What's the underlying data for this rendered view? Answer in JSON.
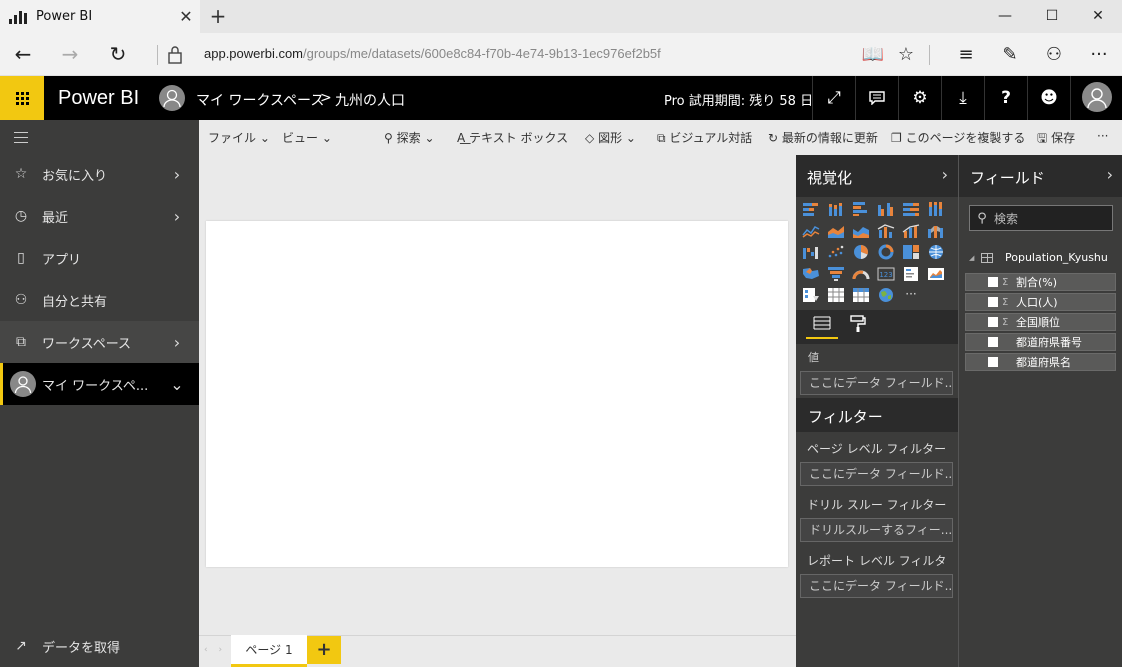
{
  "browser": {
    "tab_title": "Power BI",
    "tab_close": "✕",
    "new_tab": "+",
    "url_host": "app.powerbi.com",
    "url_path": "/groups/me/datasets/600e8c84-f70b-4e74-9b13-1ec976ef2b5f",
    "window_controls": [
      "—",
      "☐",
      "✕"
    ]
  },
  "header": {
    "brand": "Power BI",
    "breadcrumb_workspace": "マイ ワークスペース",
    "breadcrumb_sep": ">",
    "breadcrumb_dataset": "九州の人口",
    "trial_text": "Pro 試用期間: 残り 58 日",
    "icons": [
      "expand-icon",
      "feedback-icon",
      "settings-icon",
      "download-icon",
      "help-icon",
      "smiley-icon"
    ]
  },
  "leftnav": {
    "items": [
      {
        "label": "お気に入り",
        "icon": "star-icon",
        "glyph": "☆",
        "chevron": "›"
      },
      {
        "label": "最近",
        "icon": "clock-icon",
        "glyph": "◷",
        "chevron": "›"
      },
      {
        "label": "アプリ",
        "icon": "apps-icon",
        "glyph": "▯",
        "chevron": ""
      },
      {
        "label": "自分と共有",
        "icon": "share-icon",
        "glyph": "⚇",
        "chevron": ""
      },
      {
        "label": "ワークスペース",
        "icon": "workspace-icon",
        "glyph": "⧉",
        "chevron": "›"
      },
      {
        "label": "マイ ワークスペ...",
        "icon": "avatar-icon",
        "glyph": "",
        "chevron": "⌄"
      }
    ],
    "get_data": "データを取得",
    "get_data_glyph": "↗"
  },
  "toolbar": {
    "file": "ファイル",
    "view": "ビュー",
    "explore": "探索",
    "textbox": "テキスト ボックス",
    "shapes": "図形",
    "visual_qa": "ビジュアル対話",
    "refresh": "最新の情報に更新",
    "duplicate": "このページを複製する",
    "save": "保存",
    "more": "···"
  },
  "pages": {
    "current": "ページ 1",
    "add": "+",
    "nav": "‹ ›"
  },
  "visualizations": {
    "title": "視覚化",
    "chevron": "›",
    "more": "···",
    "values_label": "値",
    "values_placeholder": "ここにデータ フィールド...",
    "filters_title": "フィルター",
    "page_filter_label": "ページ レベル フィルター",
    "page_filter_placeholder": "ここにデータ フィールド...",
    "drill_filter_label": "ドリル スルー フィルター",
    "drill_filter_placeholder": "ドリルスルーするフィー...",
    "report_filter_label": "レポート レベル フィルター",
    "report_filter_placeholder": "ここにデータ フィールド..."
  },
  "fields": {
    "title": "フィールド",
    "chevron": "›",
    "search_placeholder": "検索",
    "table_name": "Population_Kyushu",
    "items": [
      {
        "name": "割合(%)",
        "sigma": "Σ"
      },
      {
        "name": "人口(人)",
        "sigma": "Σ"
      },
      {
        "name": "全国順位",
        "sigma": "Σ"
      },
      {
        "name": "都道府県番号",
        "sigma": ""
      },
      {
        "name": "都道府県名",
        "sigma": ""
      }
    ]
  },
  "colors": {
    "accent": "#F2C811",
    "header_bg": "#000000",
    "pane_bg": "#3C3C3B",
    "viz_orange": "#E8843C",
    "viz_blue": "#4A90D9"
  }
}
